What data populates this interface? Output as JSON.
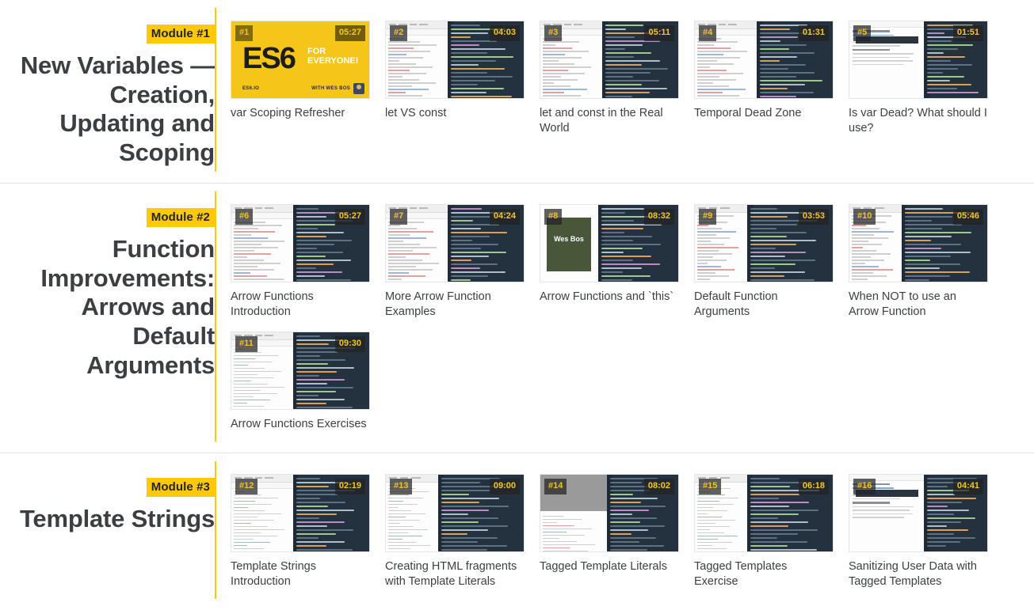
{
  "course": {
    "accent_color": "#FFC80A",
    "title_color": "#3B3F42"
  },
  "modules": [
    {
      "badge": "Module #1",
      "title": "New Variables — Creation, Updating and Scoping",
      "videos": [
        {
          "number": "#1",
          "duration": "05:27",
          "title": "var Scoping Refresher",
          "art": "hero"
        },
        {
          "number": "#2",
          "duration": "04:03",
          "title": "let VS const",
          "art": "devtools"
        },
        {
          "number": "#3",
          "duration": "05:11",
          "title": "let and const in the Real World",
          "art": "devtools"
        },
        {
          "number": "#4",
          "duration": "01:31",
          "title": "Temporal Dead Zone",
          "art": "devtools"
        },
        {
          "number": "#5",
          "duration": "01:51",
          "title": "Is var Dead? What should I use?",
          "art": "article"
        }
      ]
    },
    {
      "badge": "Module #2",
      "title": "Function Improvements: Arrows and Default Arguments",
      "videos": [
        {
          "number": "#6",
          "duration": "05:27",
          "title": "Arrow Functions Introduction",
          "art": "devtools"
        },
        {
          "number": "#7",
          "duration": "04:24",
          "title": "More Arrow Function Examples",
          "art": "devtools"
        },
        {
          "number": "#8",
          "duration": "08:32",
          "title": "Arrow Functions and `this`",
          "art": "photo",
          "photo_label": "Wes Bos"
        },
        {
          "number": "#9",
          "duration": "03:53",
          "title": "Default Function Arguments",
          "art": "editor"
        },
        {
          "number": "#10",
          "duration": "05:46",
          "title": "When NOT to use an Arrow Function",
          "art": "editor"
        },
        {
          "number": "#11",
          "duration": "09:30",
          "title": "Arrow Functions Exercises",
          "art": "devtools"
        }
      ]
    },
    {
      "badge": "Module #3",
      "title": "Template Strings",
      "videos": [
        {
          "number": "#12",
          "duration": "02:19",
          "title": "Template Strings Introduction",
          "art": "devtools"
        },
        {
          "number": "#13",
          "duration": "09:00",
          "title": "Creating HTML fragments with Template Literals",
          "art": "editor"
        },
        {
          "number": "#14",
          "duration": "08:02",
          "title": "Tagged Template Literals",
          "art": "gray"
        },
        {
          "number": "#15",
          "duration": "06:18",
          "title": "Tagged Templates Exercise",
          "art": "editor"
        },
        {
          "number": "#16",
          "duration": "04:41",
          "title": "Sanitizing User Data with Tagged Templates",
          "art": "article"
        }
      ]
    }
  ]
}
